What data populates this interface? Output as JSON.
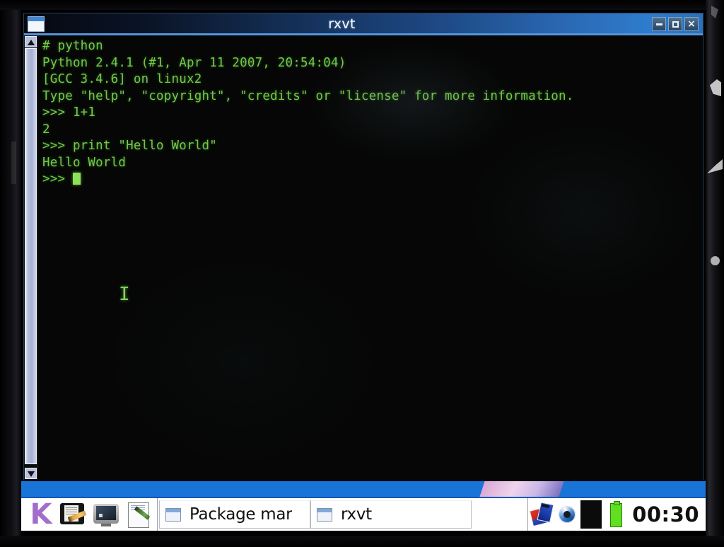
{
  "window": {
    "title": "rxvt",
    "menu_icon": "window-menu-icon",
    "buttons": [
      {
        "name": "minimize",
        "glyph": "minimize-icon"
      },
      {
        "name": "maximize",
        "glyph": "maximize-icon"
      },
      {
        "name": "close",
        "glyph": "close-icon"
      }
    ]
  },
  "terminal": {
    "foreground_color": "#72c94b",
    "background_color": "#050605",
    "cursor": "block",
    "lines": [
      "# python",
      "Python 2.4.1 (#1, Apr 11 2007, 20:54:04)",
      "[GCC 3.4.6] on linux2",
      "Type \"help\", \"copyright\", \"credits\" or \"license\" for more information.",
      ">>> 1+1",
      "2",
      ">>> print \"Hello World\"",
      "Hello World"
    ],
    "prompt": ">>> ",
    "mouse_cursor": "I"
  },
  "scrollbar": {
    "up_arrow": "scroll-up-arrow",
    "down_arrow": "scroll-down-arrow",
    "thumb": "scroll-thumb"
  },
  "taskbar": {
    "launchers": [
      {
        "name": "kde-menu-launcher",
        "icon": "k-logo-icon",
        "glyph": "K"
      },
      {
        "name": "image-editor-launcher",
        "icon": "paint-icon"
      },
      {
        "name": "terminal-launcher",
        "icon": "monitor-icon"
      },
      {
        "name": "text-editor-launcher",
        "icon": "document-pen-icon"
      }
    ],
    "windows": [
      {
        "name": "task-package-manager",
        "label": "Package mar",
        "icon": "window-icon"
      },
      {
        "name": "task-rxvt",
        "label": "rxvt",
        "icon": "window-icon"
      }
    ],
    "tray": [
      {
        "name": "package-updates-tray-icon",
        "icon": "package-icon"
      },
      {
        "name": "network-tray-icon",
        "icon": "network-swirl-icon"
      },
      {
        "name": "blank-tray-icon",
        "icon": "black-square-icon"
      },
      {
        "name": "battery-tray-icon",
        "icon": "battery-icon"
      }
    ],
    "clock": "00:30",
    "accent_color": "#0b59b8"
  },
  "desktop": {
    "strip_color": "#1a74d8"
  }
}
